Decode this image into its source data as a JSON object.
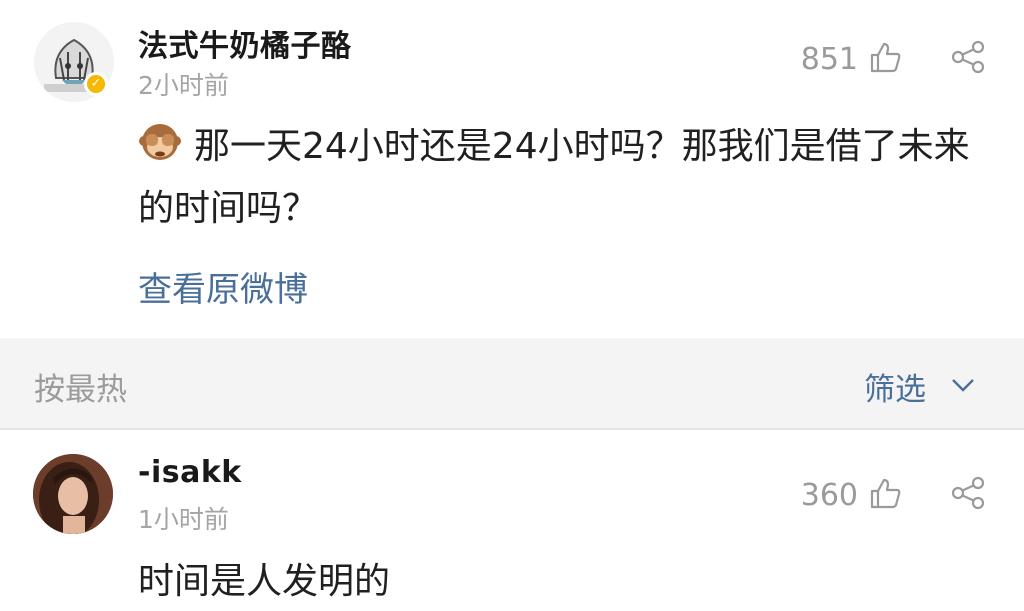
{
  "post": {
    "author": "法式牛奶橘子酪",
    "time": "2小时前",
    "likes": "851",
    "text": "那一天24小时还是24小时吗？那我们是借了未来的时间吗？",
    "view_original": "查看原微博"
  },
  "sort_bar": {
    "sort_label": "按最热",
    "filter_label": "筛选"
  },
  "comment": {
    "author": "-isakk",
    "time": "1小时前",
    "likes": "360",
    "text": "时间是人发明的"
  },
  "icons": {
    "like": "thumbs-up-icon",
    "share": "share-icon",
    "verified": "verified-badge-icon",
    "emoji": "see-no-evil-monkey-icon",
    "filter": "chevron-down-icon"
  },
  "colors": {
    "link": "#4a6f9a",
    "muted": "#a5a5a5",
    "verified": "#f6b800",
    "sort_bar_bg": "#f4f4f4"
  }
}
